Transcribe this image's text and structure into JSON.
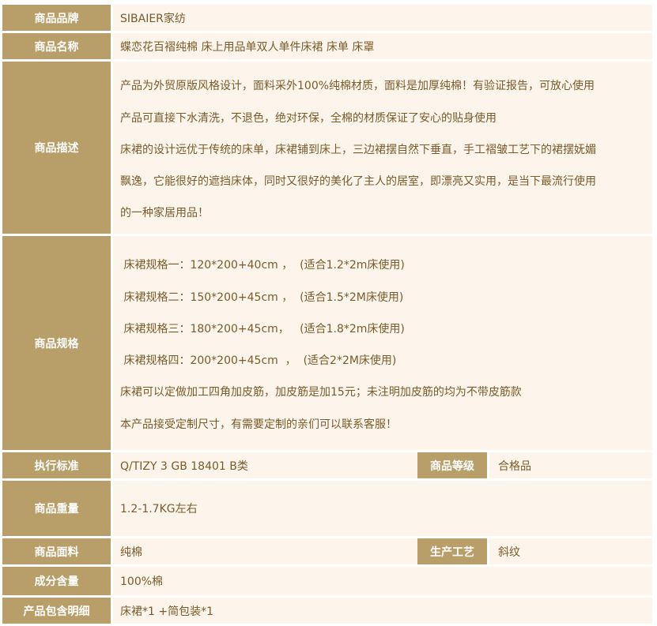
{
  "rows": {
    "brand": {
      "label": "商品品牌",
      "value": "SIBAIER家纺"
    },
    "name": {
      "label": "商品名称",
      "value": "蝶恋花百褶纯棉 床上用品单双人单件床裙 床单 床罩"
    },
    "description": {
      "label": "商品描述",
      "lines": [
        "产品为外贸原版风格设计，面料采外100%纯棉材质，面料是加厚纯棉！有验证报告，可放心使用",
        "产品可直接下水清洗，不退色，绝对环保，全棉的材质保证了安心的贴身使用",
        "床裙的设计远优于传统的床单，床裙铺到床上，三边裙摆自然下垂直，手工褶皱工艺下的裙摆妩媚",
        "飘逸，它能很好的遮挡床体，同时又很好的美化了主人的居室，即漂亮又实用，是当下最流行使用",
        "的一种家居用品！"
      ]
    },
    "spec": {
      "label": "商品规格",
      "lines": [
        " 床裙规格一：120*200+40cm ，  (适合1.2*2m床使用)",
        " 床裙规格二：150*200+45cm ，  (适合1.5*2M床使用)",
        " 床裙规格三：180*200+45cm，   (适合1.8*2m床使用)",
        " 床裙规格四：200*200+45cm  ，  (适合2*2M床使用)",
        "床裙可以定做加工四角加皮筋，加皮筋是加15元；未注明加皮筋的均为不带皮筋款",
        "本产品接受定制尺寸，有需要定制的亲们可以联系客服！"
      ]
    },
    "standard": {
      "label": "执行标准",
      "value": "Q/TIZY 3 GB 18401 B类",
      "label2": "商品等级",
      "value2": "合格品"
    },
    "weight": {
      "label": "商品重量",
      "value": "1.2-1.7KG左右"
    },
    "fabric": {
      "label": "商品面料",
      "value": "纯棉",
      "label2": "生产工艺",
      "value2": "斜纹"
    },
    "content": {
      "label": "成分含量",
      "value": "100%棉"
    },
    "package": {
      "label": "产品包含明细",
      "value": "床裙*1 +简包装*1"
    }
  }
}
